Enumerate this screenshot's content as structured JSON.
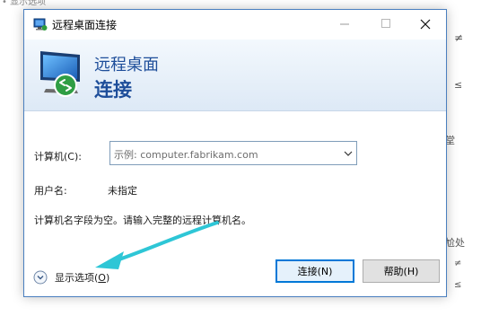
{
  "background": {
    "fragments": [
      "• 显示选项",
      "≠",
      "≤",
      "堂",
      "尬处",
      "≠",
      "≤"
    ]
  },
  "window": {
    "title": "远程桌面连接",
    "controls": {
      "minimize": "minimize-icon",
      "maximize": "maximize-icon",
      "close": "close-icon"
    }
  },
  "banner": {
    "subtitle": "远程桌面",
    "title": "连接",
    "icon": "remote-monitor-icon"
  },
  "form": {
    "computer_label": "计算机(C):",
    "computer_placeholder": "示例: computer.fabrikam.com",
    "user_label": "用户名:",
    "user_value": "未指定",
    "message": "计算机名字段为空。请输入完整的远程计算机名。"
  },
  "footer": {
    "options_label": "显示选项(",
    "options_key": "O",
    "options_suffix": ")",
    "connect_label": "连接(N)",
    "help_label": "帮助(H)"
  },
  "colors": {
    "accent": "#0078d7",
    "banner_text": "#1e4e9a",
    "annotation_arrow": "#2ec6d6"
  }
}
